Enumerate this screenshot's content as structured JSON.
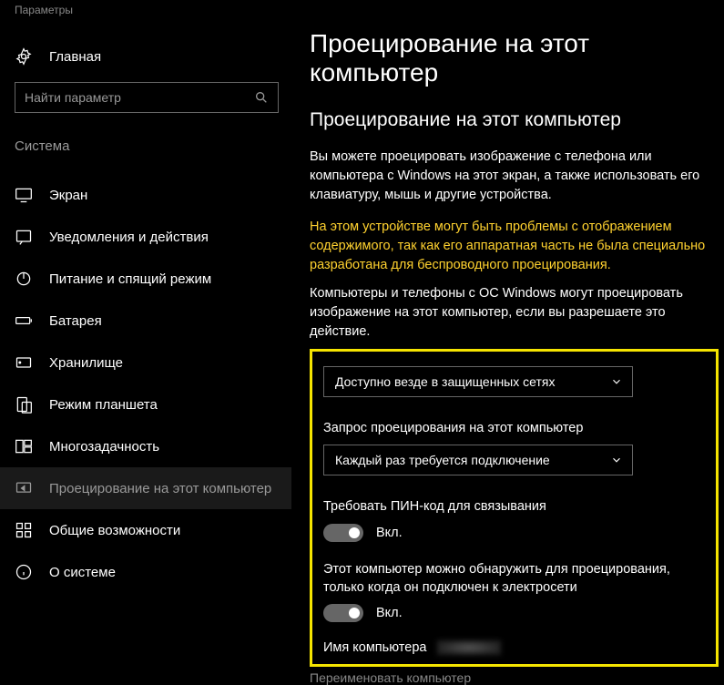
{
  "window": {
    "title": "Параметры"
  },
  "sidebar": {
    "home": "Главная",
    "search_placeholder": "Найти параметр",
    "category": "Система",
    "items": [
      {
        "label": "Экран"
      },
      {
        "label": "Уведомления и действия"
      },
      {
        "label": "Питание и спящий режим"
      },
      {
        "label": "Батарея"
      },
      {
        "label": "Хранилище"
      },
      {
        "label": "Режим планшета"
      },
      {
        "label": "Многозадачность"
      },
      {
        "label": "Проецирование на этот компьютер"
      },
      {
        "label": "Общие возможности"
      },
      {
        "label": "О системе"
      }
    ]
  },
  "main": {
    "title": "Проецирование на этот компьютер",
    "section": "Проецирование на этот компьютер",
    "intro": "Вы можете проецировать изображение с телефона или компьютера с Windows на этот экран, а также использовать его клавиатуру, мышь и другие устройства.",
    "warning": "На этом устройстве могут быть проблемы с отображением содержимого, так как его аппаратная часть не была специально разработана для беспроводного проецирования.",
    "permission_text": "Компьютеры и телефоны с ОС Windows могут проецировать изображение на этот компьютер, если вы разрешаете это действие.",
    "dropdown1": "Доступно везде в защищенных сетях",
    "request_label": "Запрос проецирования на этот компьютер",
    "dropdown2": "Каждый раз требуется подключение",
    "pin_label": "Требовать ПИН-код для связывания",
    "pin_state": "Вкл.",
    "discover_label": "Этот компьютер можно обнаружить для проецирования, только когда он подключен к электросети",
    "discover_state": "Вкл.",
    "pc_name_label": "Имя компьютера",
    "rename": "Переименовать компьютер"
  }
}
